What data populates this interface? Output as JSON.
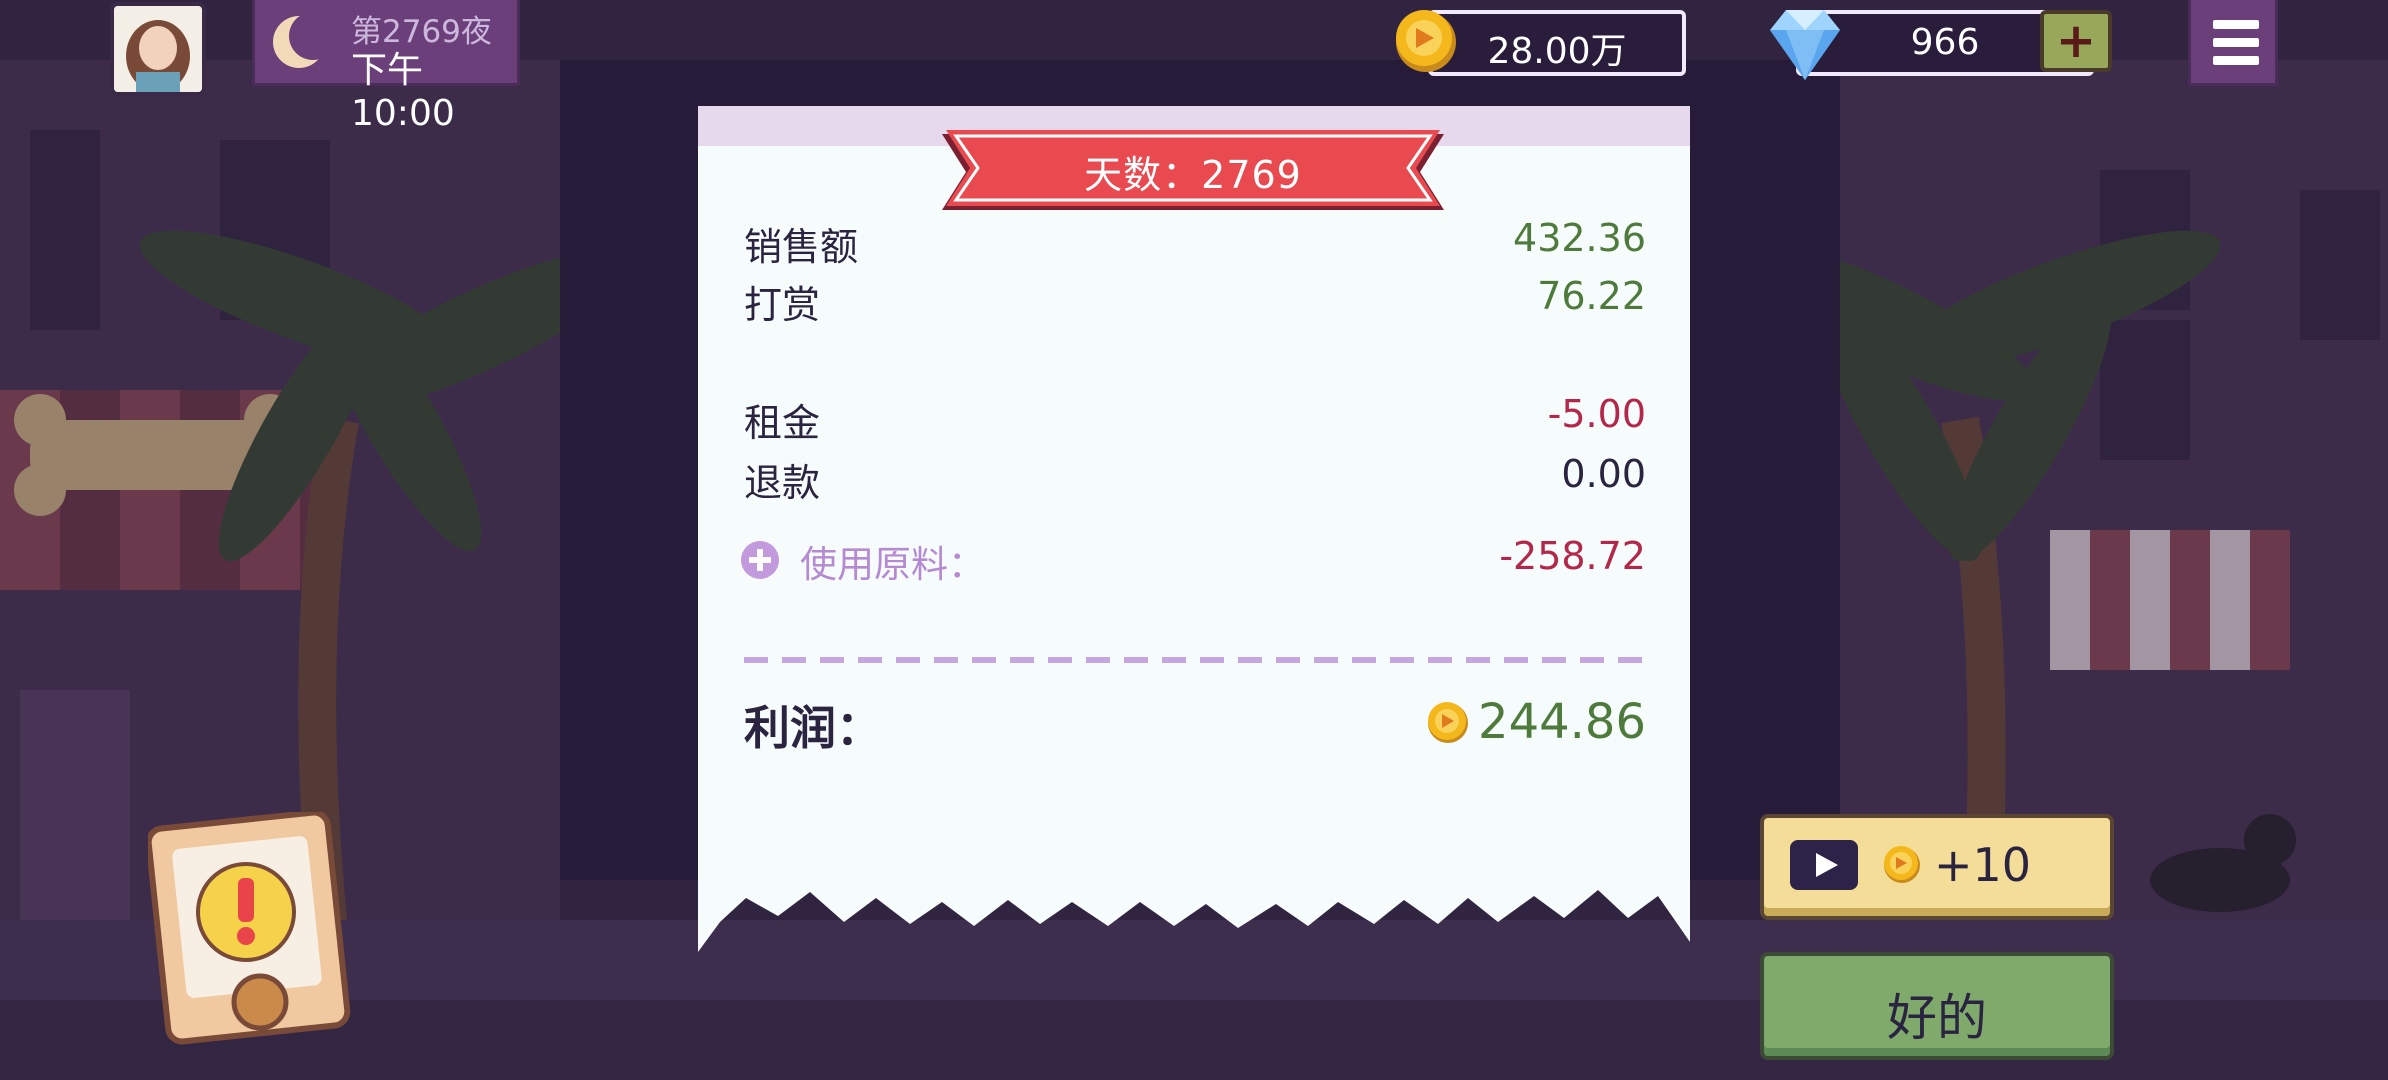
{
  "hud": {
    "night_label": "第2769夜",
    "clock": "下午10:00",
    "coins": "28.00万",
    "gems": "966",
    "plus_label": "+"
  },
  "receipt": {
    "banner": "天数：2769",
    "rows": [
      {
        "label": "销售额",
        "value": "432.36"
      },
      {
        "label": "打赏",
        "value": "76.22"
      },
      {
        "label": "租金",
        "value": "-5.00"
      },
      {
        "label": "退款",
        "value": "0.00"
      }
    ],
    "materials_label": "使用原料：",
    "materials_value": "-258.72",
    "profit_label": "利润：",
    "profit_value": "244.86"
  },
  "buttons": {
    "ad_reward": "+10",
    "ok": "好的"
  },
  "colors": {
    "positive": "#4e7a3c",
    "negative": "#b3274a",
    "banner": "#e84a50",
    "ok_button": "#7faa6c",
    "ad_button": "#f3dd98"
  }
}
